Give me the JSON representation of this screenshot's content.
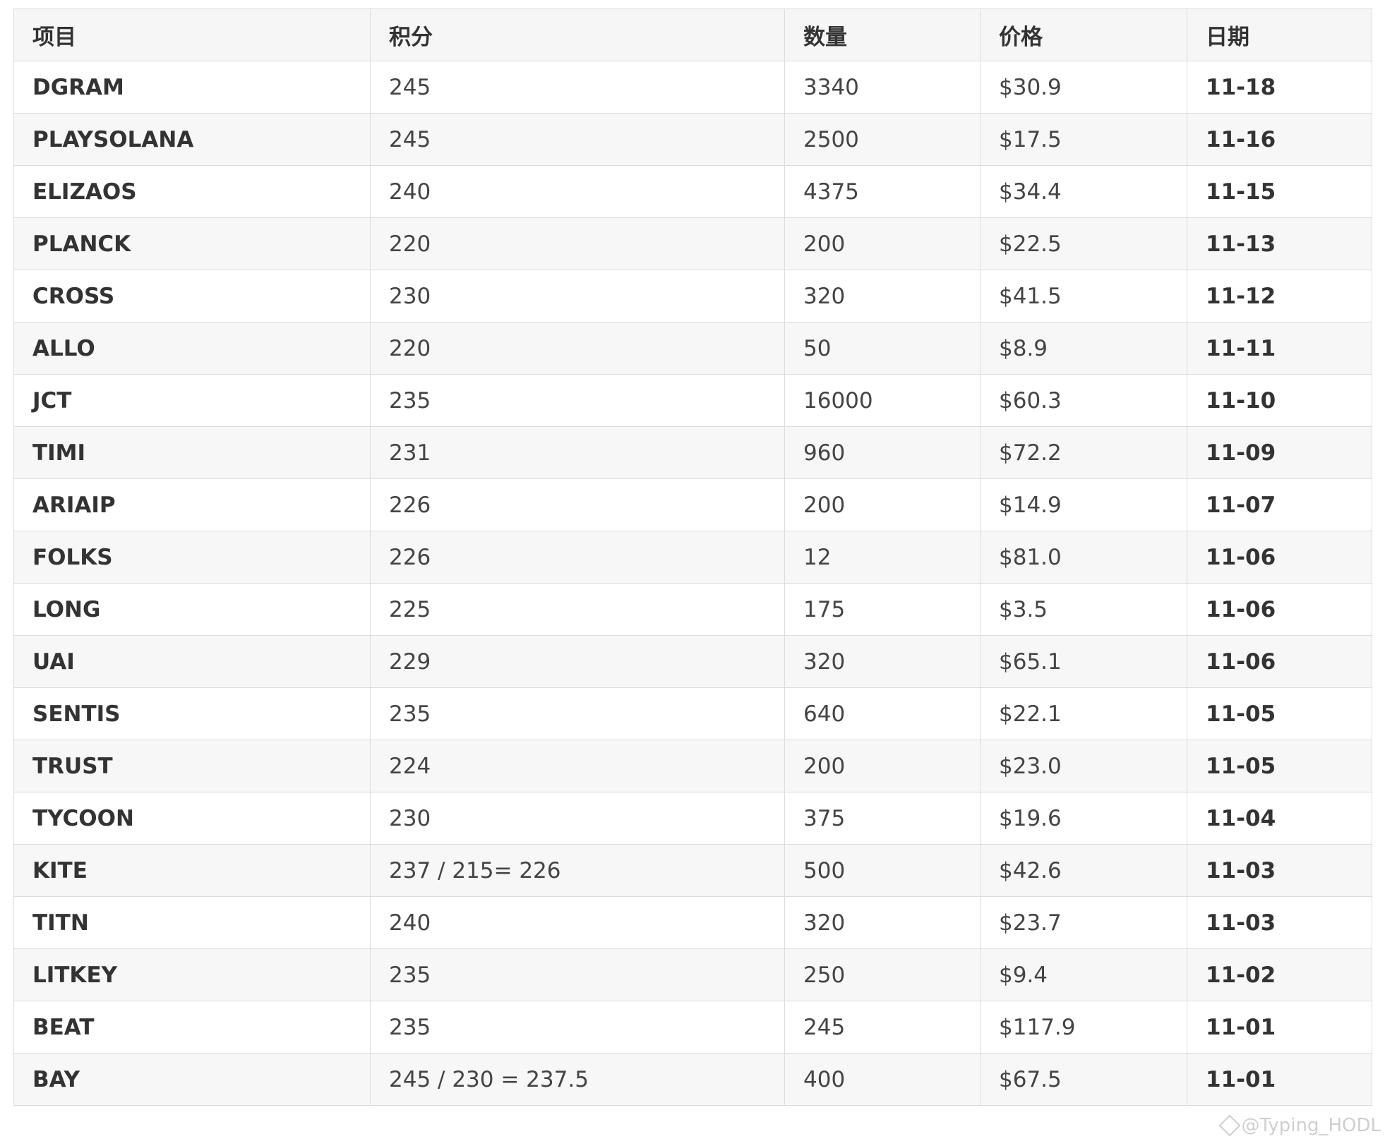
{
  "table": {
    "headers": [
      "项目",
      "积分",
      "数量",
      "价格",
      "日期"
    ],
    "rows": [
      {
        "name": "DGRAM",
        "score": "245",
        "qty": "3340",
        "price": "$30.9",
        "date": "11-18"
      },
      {
        "name": "PLAYSOLANA",
        "score": "245",
        "qty": "2500",
        "price": "$17.5",
        "date": "11-16"
      },
      {
        "name": "ELIZAOS",
        "score": "240",
        "qty": "4375",
        "price": "$34.4",
        "date": "11-15"
      },
      {
        "name": "PLANCK",
        "score": "220",
        "qty": "200",
        "price": "$22.5",
        "date": "11-13"
      },
      {
        "name": "CROSS",
        "score": "230",
        "qty": "320",
        "price": "$41.5",
        "date": "11-12"
      },
      {
        "name": "ALLO",
        "score": "220",
        "qty": "50",
        "price": "$8.9",
        "date": "11-11"
      },
      {
        "name": "JCT",
        "score": "235",
        "qty": "16000",
        "price": "$60.3",
        "date": "11-10"
      },
      {
        "name": "TIMI",
        "score": "231",
        "qty": "960",
        "price": "$72.2",
        "date": "11-09"
      },
      {
        "name": "ARIAIP",
        "score": "226",
        "qty": "200",
        "price": "$14.9",
        "date": "11-07"
      },
      {
        "name": "FOLKS",
        "score": "226",
        "qty": "12",
        "price": "$81.0",
        "date": "11-06"
      },
      {
        "name": "LONG",
        "score": "225",
        "qty": "175",
        "price": "$3.5",
        "date": "11-06"
      },
      {
        "name": "UAI",
        "score": "229",
        "qty": "320",
        "price": "$65.1",
        "date": "11-06"
      },
      {
        "name": "SENTIS",
        "score": "235",
        "qty": "640",
        "price": "$22.1",
        "date": "11-05"
      },
      {
        "name": "TRUST",
        "score": "224",
        "qty": "200",
        "price": "$23.0",
        "date": "11-05"
      },
      {
        "name": "TYCOON",
        "score": "230",
        "qty": "375",
        "price": "$19.6",
        "date": "11-04"
      },
      {
        "name": "KITE",
        "score": "237 / 215= 226",
        "qty": "500",
        "price": "$42.6",
        "date": "11-03"
      },
      {
        "name": "TITN",
        "score": "240",
        "qty": "320",
        "price": "$23.7",
        "date": "11-03"
      },
      {
        "name": "LITKEY",
        "score": "235",
        "qty": "250",
        "price": "$9.4",
        "date": "11-02"
      },
      {
        "name": "BEAT",
        "score": "235",
        "qty": "245",
        "price": "$117.9",
        "date": "11-01"
      },
      {
        "name": "BAY",
        "score": "245 / 230 = 237.5",
        "qty": "400",
        "price": "$67.5",
        "date": "11-01"
      }
    ]
  },
  "watermark": {
    "text": "@Typing_HODL",
    "icon": "binance-square-icon"
  }
}
